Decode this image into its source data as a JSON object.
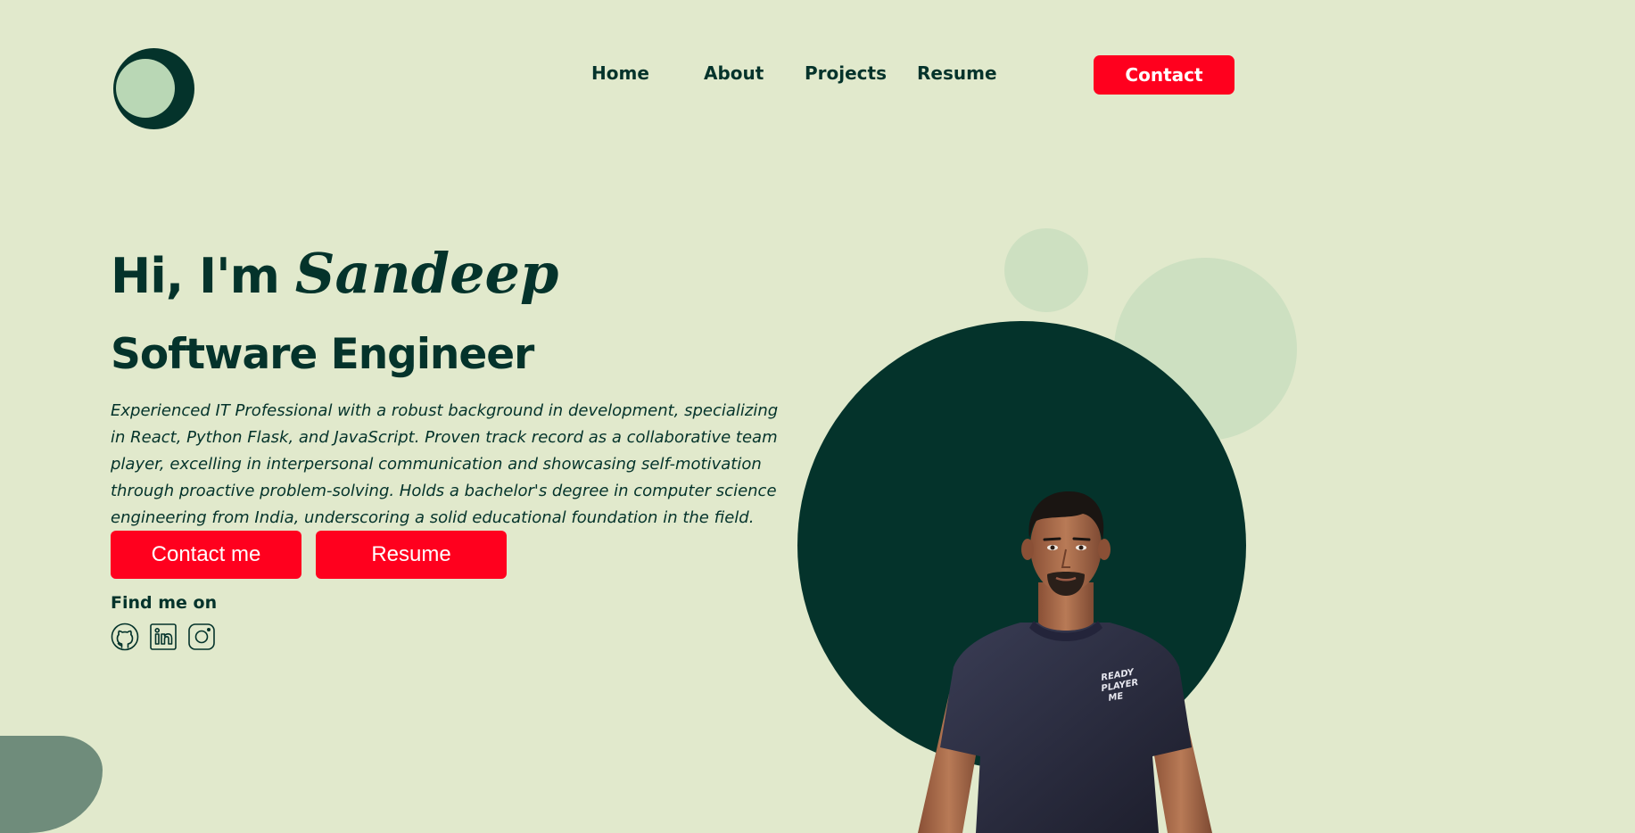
{
  "header": {
    "nav": [
      {
        "label": "Home"
      },
      {
        "label": "About"
      },
      {
        "label": "Projects"
      },
      {
        "label": "Resume"
      }
    ],
    "contact_label": "Contact"
  },
  "hero": {
    "greeting_prefix": "Hi, I'm",
    "name": "Sandeep",
    "role": "Software Engineer",
    "bio": "Experienced IT Professional with a robust background in development, specializing in React, Python Flask, and JavaScript. Proven track record as a collaborative team player, excelling in interpersonal communication and showcasing self-motivation through proactive problem-solving. Holds a bachelor's degree in computer science engineering from India, underscoring a solid educational foundation in the field.",
    "buttons": {
      "contact_me": "Contact me",
      "resume": "Resume"
    },
    "find_me_label": "Find me on",
    "socials": [
      {
        "icon": "github-icon"
      },
      {
        "icon": "linkedin-icon"
      },
      {
        "icon": "instagram-icon"
      }
    ]
  },
  "avatar": {
    "shirt_text": [
      "READY",
      "PLAYER",
      "ME"
    ]
  },
  "colors": {
    "background": "#e1e9cc",
    "primary_dark": "#04332b",
    "accent_red": "#ff001e",
    "logo_light": "#b9d7b5",
    "bubble": "#cde0c1",
    "blob": "#6f8c7b"
  }
}
